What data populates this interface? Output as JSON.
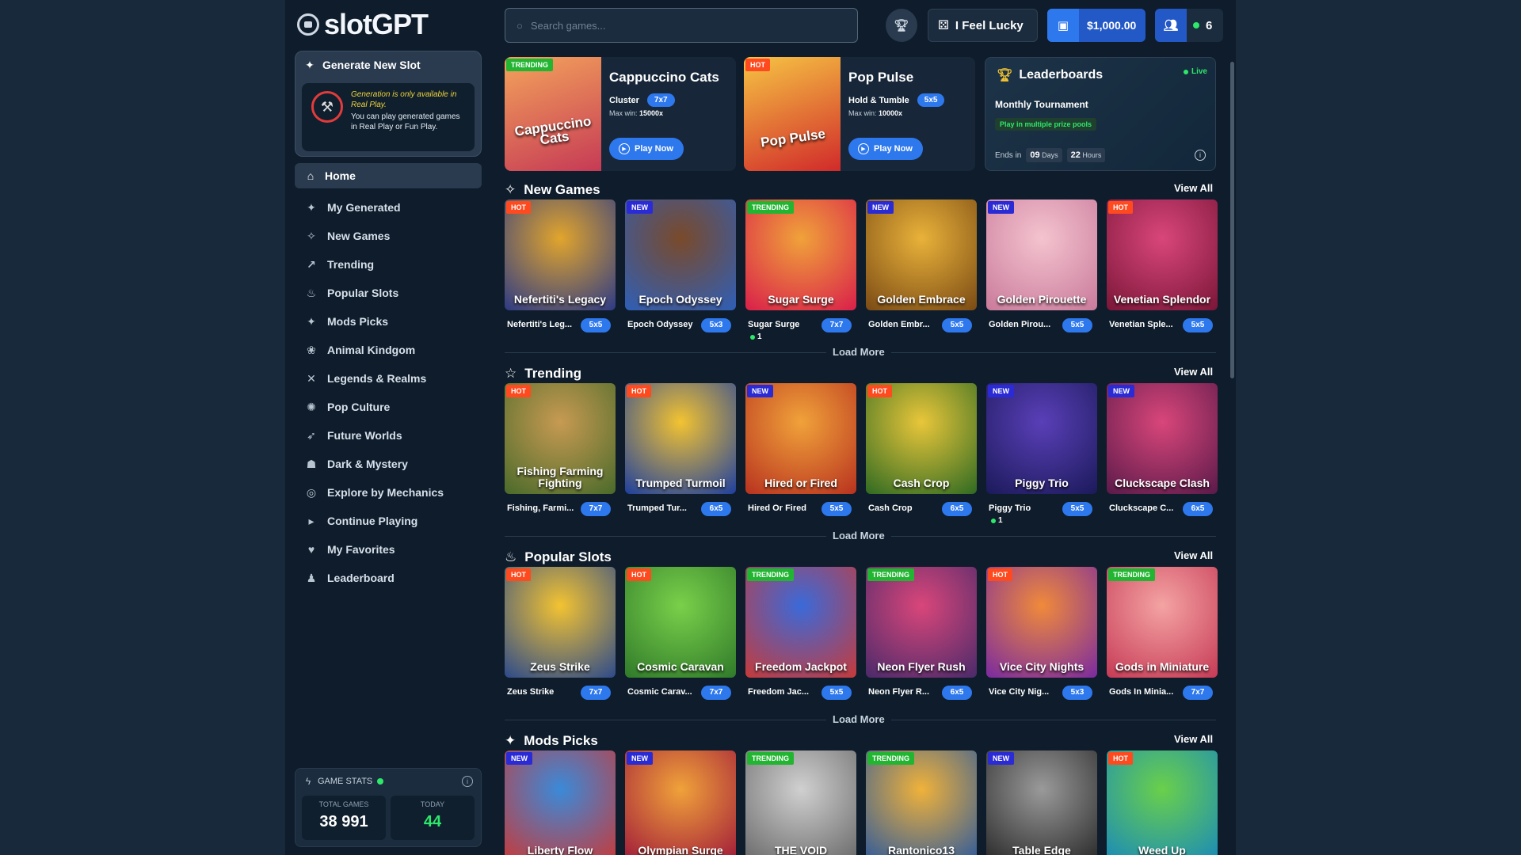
{
  "brand": "slotGPT",
  "sidebar": {
    "generate_title": "Generate New Slot",
    "generate_warning": "Generation is only available in Real Play.",
    "generate_text": "You can play generated games in Real Play or Fun Play.",
    "home": "Home",
    "items": [
      {
        "label": "My Generated",
        "icon": "sparkle-icon"
      },
      {
        "label": "New Games",
        "icon": "sparkles-icon"
      },
      {
        "label": "Trending",
        "icon": "trending-icon"
      },
      {
        "label": "Popular Slots",
        "icon": "flame-icon"
      },
      {
        "label": "Mods Picks",
        "icon": "star-icon"
      },
      {
        "label": "Animal Kindgom",
        "icon": "paw-icon"
      },
      {
        "label": "Legends & Realms",
        "icon": "swords-icon"
      },
      {
        "label": "Pop Culture",
        "icon": "party-icon"
      },
      {
        "label": "Future Worlds",
        "icon": "rocket-icon"
      },
      {
        "label": "Dark & Mystery",
        "icon": "ghost-icon"
      },
      {
        "label": "Explore by Mechanics",
        "icon": "compass-icon"
      },
      {
        "label": "Continue Playing",
        "icon": "play-circle-icon"
      },
      {
        "label": "My Favorites",
        "icon": "heart-icon"
      },
      {
        "label": "Leaderboard",
        "icon": "podium-icon"
      }
    ],
    "stats": {
      "title": "GAME STATS",
      "total_label": "TOTAL GAMES",
      "total": "38 991",
      "today_label": "TODAY",
      "today": "44"
    }
  },
  "header": {
    "search_placeholder": "Search games...",
    "lucky": "I Feel Lucky",
    "balance": "$1,000.00",
    "online": "6"
  },
  "featured": [
    {
      "name": "Cappuccino Cats",
      "badge": "TRENDING",
      "mechanic": "Cluster",
      "grid": "7x7",
      "max_label": "Max win:",
      "max": "15000x",
      "play": "Play Now",
      "colors": [
        "#f3a35b",
        "#c63a55"
      ]
    },
    {
      "name": "Pop Pulse",
      "badge": "HOT",
      "mechanic": "Hold & Tumble",
      "grid": "5x5",
      "max_label": "Max win:",
      "max": "10000x",
      "play": "Play Now",
      "colors": [
        "#f6c443",
        "#d12a2a"
      ]
    }
  ],
  "leaderboard": {
    "title": "Leaderboards",
    "live": "Live",
    "subtitle": "Monthly Tournament",
    "pool": "Play in multiple prize pools",
    "ends": "Ends in",
    "days": "09",
    "days_unit": "Days",
    "hours": "22",
    "hours_unit": "Hours"
  },
  "sections": [
    {
      "title": "New Games",
      "icon": "sparkles-icon",
      "view_all": "View All",
      "load_more": "Load More",
      "games": [
        {
          "name": "Nefertiti's Legacy",
          "art": "Nefertiti's Legacy",
          "caption": "Nefertiti's Leg...",
          "grid": "5x5",
          "badge": "HOT",
          "count": "",
          "colors": [
            "#e2a52c",
            "#2c3a85"
          ]
        },
        {
          "name": "Epoch Odyssey",
          "art": "Epoch Odyssey",
          "caption": "Epoch Odyssey",
          "grid": "5x3",
          "badge": "NEW",
          "count": "",
          "colors": [
            "#7a4a2a",
            "#2e5fb8"
          ]
        },
        {
          "name": "Sugar Surge",
          "art": "Sugar Surge",
          "caption": "Sugar Surge",
          "grid": "7x7",
          "badge": "TRENDING",
          "count": "1",
          "colors": [
            "#f0a23a",
            "#d91f4a"
          ]
        },
        {
          "name": "Golden Embrace",
          "art": "Golden Embrace",
          "caption": "Golden Embr...",
          "grid": "5x5",
          "badge": "NEW",
          "count": "",
          "colors": [
            "#e9b23a",
            "#7a4a14"
          ]
        },
        {
          "name": "Golden Pirouette",
          "art": "Golden Pirouette",
          "caption": "Golden Pirou...",
          "grid": "5x5",
          "badge": "NEW",
          "count": "",
          "colors": [
            "#f4c3cf",
            "#c97a9a"
          ]
        },
        {
          "name": "Venetian Splendor",
          "art": "Venetian Splendor",
          "caption": "Venetian Sple...",
          "grid": "5x5",
          "badge": "HOT",
          "count": "",
          "colors": [
            "#d9467a",
            "#7a1638"
          ]
        }
      ]
    },
    {
      "title": "Trending",
      "icon": "star-outline-icon",
      "view_all": "View All",
      "load_more": "Load More",
      "games": [
        {
          "name": "Fishing, Farming, Fighting",
          "art": "Fishing Farming Fighting",
          "caption": "Fishing, Farmi...",
          "grid": "7x7",
          "badge": "HOT",
          "count": "",
          "colors": [
            "#c79a52",
            "#4a6a2a"
          ]
        },
        {
          "name": "Trumped Turmoil",
          "art": "Trumped Turmoil",
          "caption": "Trumped Tur...",
          "grid": "6x5",
          "badge": "HOT",
          "count": "",
          "colors": [
            "#f3c331",
            "#1d3f9e"
          ]
        },
        {
          "name": "Hired Or Fired",
          "art": "Hired or Fired",
          "caption": "Hired Or Fired",
          "grid": "5x5",
          "badge": "NEW",
          "count": "",
          "colors": [
            "#f0a23a",
            "#b8321f"
          ]
        },
        {
          "name": "Cash Crop",
          "art": "Cash Crop",
          "caption": "Cash Crop",
          "grid": "6x5",
          "badge": "HOT",
          "count": "",
          "colors": [
            "#e9c63a",
            "#2f6a22"
          ]
        },
        {
          "name": "Piggy Trio",
          "art": "Piggy Trio",
          "caption": "Piggy Trio",
          "grid": "5x5",
          "badge": "NEW",
          "count": "1",
          "colors": [
            "#5a3fb8",
            "#1b1a5a"
          ]
        },
        {
          "name": "Cluckscape Clash",
          "art": "Cluckscape Clash",
          "caption": "Cluckscape C...",
          "grid": "6x5",
          "badge": "NEW",
          "count": "",
          "colors": [
            "#d9467a",
            "#5a1a4a"
          ]
        }
      ]
    },
    {
      "title": "Popular Slots",
      "icon": "flame-icon",
      "view_all": "View All",
      "load_more": "Load More",
      "games": [
        {
          "name": "Zeus Strike",
          "art": "Zeus Strike",
          "caption": "Zeus Strike",
          "grid": "7x7",
          "badge": "HOT",
          "count": "",
          "colors": [
            "#f3c331",
            "#2c4a8a"
          ]
        },
        {
          "name": "Cosmic Caravan",
          "art": "Cosmic Caravan",
          "caption": "Cosmic Carav...",
          "grid": "7x7",
          "badge": "HOT",
          "count": "",
          "colors": [
            "#7ad04a",
            "#2f7a2a"
          ]
        },
        {
          "name": "Freedom Jackpot",
          "art": "Freedom Jackpot",
          "caption": "Freedom Jac...",
          "grid": "5x5",
          "badge": "TRENDING",
          "count": "",
          "colors": [
            "#3a6ad9",
            "#c63a3a"
          ]
        },
        {
          "name": "Neon Flyer Rush",
          "art": "Neon Flyer Rush",
          "caption": "Neon Flyer R...",
          "grid": "6x5",
          "badge": "TRENDING",
          "count": "",
          "colors": [
            "#d9467a",
            "#4a2a6a"
          ]
        },
        {
          "name": "Vice City Nights",
          "art": "Vice City Nights",
          "caption": "Vice City Nig...",
          "grid": "5x3",
          "badge": "HOT",
          "count": "",
          "colors": [
            "#f08a3a",
            "#7a2aa0"
          ]
        },
        {
          "name": "Gods in Miniature",
          "art": "Gods in Miniature",
          "caption": "Gods In Minia...",
          "grid": "7x7",
          "badge": "TRENDING",
          "count": "",
          "colors": [
            "#f4a3a3",
            "#c63a55"
          ]
        }
      ]
    },
    {
      "title": "Mods Picks",
      "icon": "star-icon",
      "view_all": "View All",
      "load_more": "",
      "games": [
        {
          "name": "Liberty Flow",
          "art": "Liberty Flow",
          "caption": "",
          "grid": "",
          "badge": "NEW",
          "count": "",
          "colors": [
            "#3a8ad9",
            "#c63a3a"
          ]
        },
        {
          "name": "Olympian Surge",
          "art": "Olympian Surge",
          "caption": "",
          "grid": "",
          "badge": "NEW",
          "count": "",
          "colors": [
            "#f0a23a",
            "#a01a3a"
          ]
        },
        {
          "name": "The Void",
          "art": "THE VOID",
          "caption": "",
          "grid": "",
          "badge": "TRENDING",
          "count": "",
          "colors": [
            "#d0d0d0",
            "#6a6a6a"
          ]
        },
        {
          "name": "Rantonico13",
          "art": "Rantonico13",
          "caption": "",
          "grid": "",
          "badge": "TRENDING",
          "count": "",
          "colors": [
            "#f0b23a",
            "#2f5a9a"
          ]
        },
        {
          "name": "Table Edge",
          "art": "Table Edge",
          "caption": "",
          "grid": "",
          "badge": "NEW",
          "count": "",
          "colors": [
            "#9a9a9a",
            "#2a2a2a"
          ]
        },
        {
          "name": "Weed Up",
          "art": "Weed Up",
          "caption": "",
          "grid": "",
          "badge": "HOT",
          "count": "",
          "colors": [
            "#6ad04a",
            "#1a8ab8"
          ]
        }
      ]
    }
  ]
}
